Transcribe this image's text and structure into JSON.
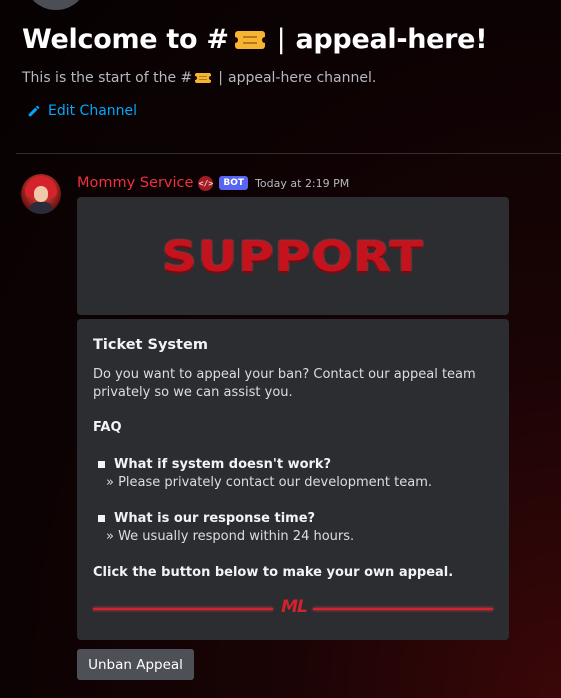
{
  "header": {
    "welcome_prefix": "Welcome to #",
    "channel_name": "appeal-here!",
    "separator": "|",
    "subtitle_prefix": "This is the start of the #",
    "subtitle_channel": "appeal-here channel.",
    "edit_label": "Edit Channel",
    "icons": [
      "ticket-icon",
      "pencil-icon"
    ]
  },
  "message": {
    "author": "Mommy Service",
    "role_icon": "</>",
    "bot_tag": "BOT",
    "timestamp": "Today at 2:19 PM",
    "banner_text": "SUPPORT",
    "embed": {
      "title": "Ticket System",
      "description": "Do you want to appeal your ban? Contact our appeal team privately so we can assist you.",
      "faq_heading": "FAQ",
      "faq": [
        {
          "question": "What if system doesn't work?",
          "answer": "» Please privately contact our development team."
        },
        {
          "question": "What is our response time?",
          "answer": "» We usually respond within 24 hours."
        }
      ],
      "cta": "Click the button below to make your own appeal.",
      "signature": "ML"
    },
    "button_label": "Unban Appeal"
  },
  "colors": {
    "author": "#f2313d",
    "link": "#00a8fc",
    "bot_tag": "#5865f2",
    "embed_bg": "#2b2d31",
    "accent_red": "#d0232c",
    "button": "#4e5058"
  }
}
